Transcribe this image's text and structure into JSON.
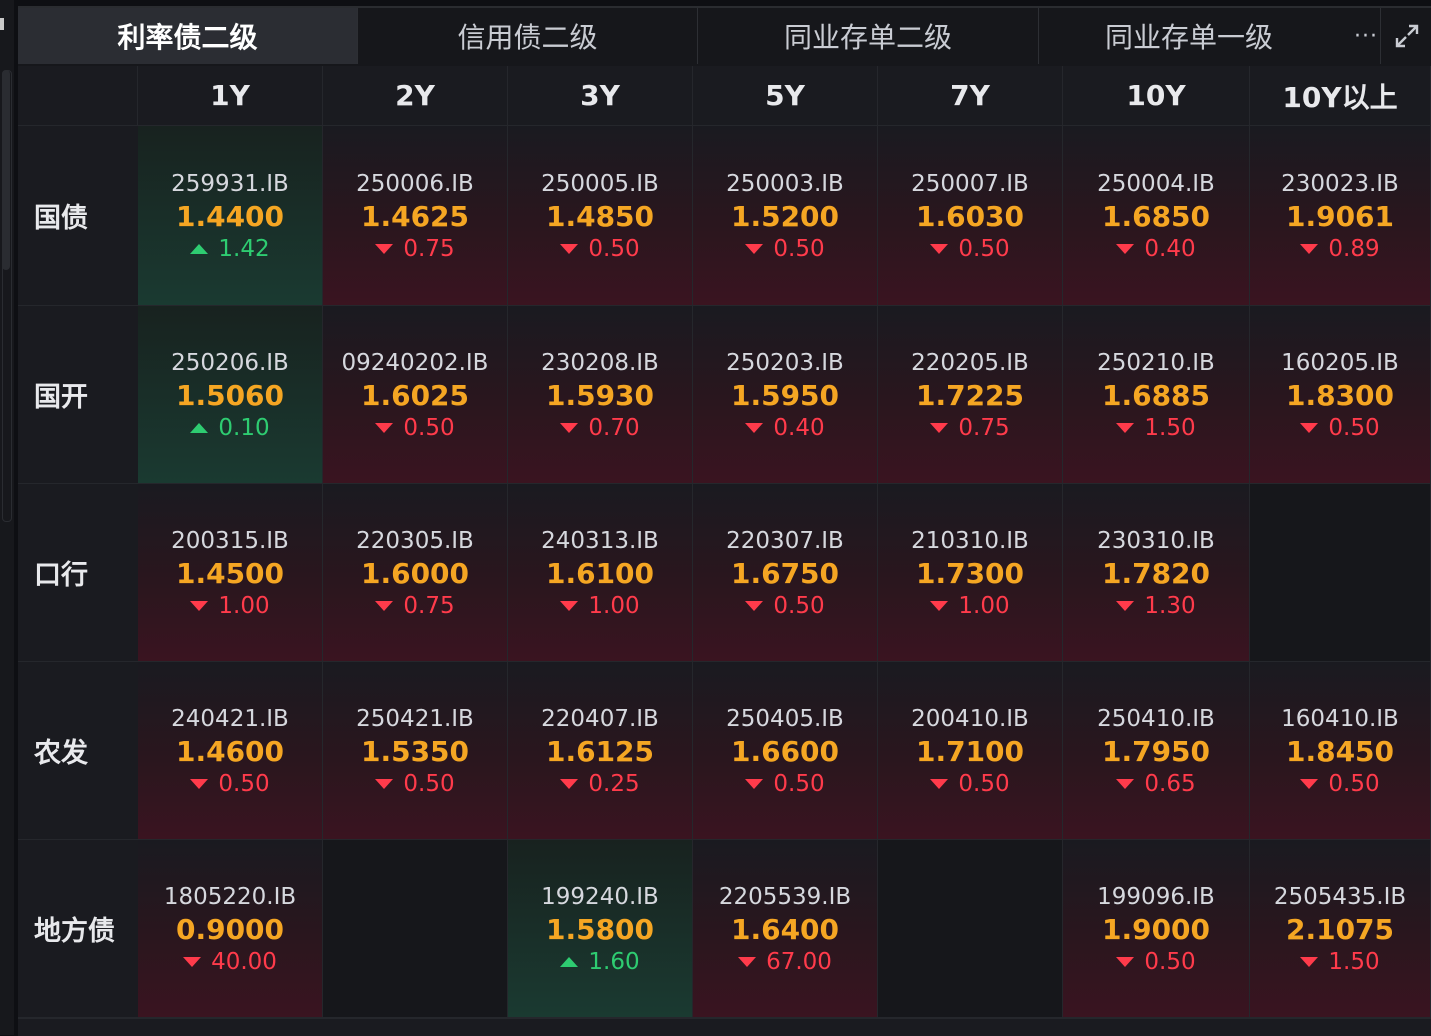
{
  "tabs": [
    {
      "label": "利率债二级",
      "active": true
    },
    {
      "label": "信用债二级",
      "active": false
    },
    {
      "label": "同业存单二级",
      "active": false
    },
    {
      "label": "同业存单一级",
      "active": false
    }
  ],
  "more_label": "···",
  "tenors": [
    "1Y",
    "2Y",
    "3Y",
    "5Y",
    "7Y",
    "10Y",
    "10Y以上"
  ],
  "rows": [
    {
      "label": "国债",
      "cells": [
        {
          "code": "259931.IB",
          "rate": "1.4400",
          "change": "1.42",
          "dir": "up"
        },
        {
          "code": "250006.IB",
          "rate": "1.4625",
          "change": "0.75",
          "dir": "down"
        },
        {
          "code": "250005.IB",
          "rate": "1.4850",
          "change": "0.50",
          "dir": "down"
        },
        {
          "code": "250003.IB",
          "rate": "1.5200",
          "change": "0.50",
          "dir": "down"
        },
        {
          "code": "250007.IB",
          "rate": "1.6030",
          "change": "0.50",
          "dir": "down"
        },
        {
          "code": "250004.IB",
          "rate": "1.6850",
          "change": "0.40",
          "dir": "down"
        },
        {
          "code": "230023.IB",
          "rate": "1.9061",
          "change": "0.89",
          "dir": "down"
        }
      ]
    },
    {
      "label": "国开",
      "cells": [
        {
          "code": "250206.IB",
          "rate": "1.5060",
          "change": "0.10",
          "dir": "up"
        },
        {
          "code": "09240202.IB",
          "rate": "1.6025",
          "change": "0.50",
          "dir": "down"
        },
        {
          "code": "230208.IB",
          "rate": "1.5930",
          "change": "0.70",
          "dir": "down"
        },
        {
          "code": "250203.IB",
          "rate": "1.5950",
          "change": "0.40",
          "dir": "down"
        },
        {
          "code": "220205.IB",
          "rate": "1.7225",
          "change": "0.75",
          "dir": "down"
        },
        {
          "code": "250210.IB",
          "rate": "1.6885",
          "change": "1.50",
          "dir": "down"
        },
        {
          "code": "160205.IB",
          "rate": "1.8300",
          "change": "0.50",
          "dir": "down"
        }
      ]
    },
    {
      "label": "口行",
      "cells": [
        {
          "code": "200315.IB",
          "rate": "1.4500",
          "change": "1.00",
          "dir": "down"
        },
        {
          "code": "220305.IB",
          "rate": "1.6000",
          "change": "0.75",
          "dir": "down"
        },
        {
          "code": "240313.IB",
          "rate": "1.6100",
          "change": "1.00",
          "dir": "down"
        },
        {
          "code": "220307.IB",
          "rate": "1.6750",
          "change": "0.50",
          "dir": "down"
        },
        {
          "code": "210310.IB",
          "rate": "1.7300",
          "change": "1.00",
          "dir": "down"
        },
        {
          "code": "230310.IB",
          "rate": "1.7820",
          "change": "1.30",
          "dir": "down"
        },
        null
      ]
    },
    {
      "label": "农发",
      "cells": [
        {
          "code": "240421.IB",
          "rate": "1.4600",
          "change": "0.50",
          "dir": "down"
        },
        {
          "code": "250421.IB",
          "rate": "1.5350",
          "change": "0.50",
          "dir": "down"
        },
        {
          "code": "220407.IB",
          "rate": "1.6125",
          "change": "0.25",
          "dir": "down"
        },
        {
          "code": "250405.IB",
          "rate": "1.6600",
          "change": "0.50",
          "dir": "down"
        },
        {
          "code": "200410.IB",
          "rate": "1.7100",
          "change": "0.50",
          "dir": "down"
        },
        {
          "code": "250410.IB",
          "rate": "1.7950",
          "change": "0.65",
          "dir": "down"
        },
        {
          "code": "160410.IB",
          "rate": "1.8450",
          "change": "0.50",
          "dir": "down"
        }
      ]
    },
    {
      "label": "地方债",
      "cells": [
        {
          "code": "1805220.IB",
          "rate": "0.9000",
          "change": "40.00",
          "dir": "down"
        },
        null,
        {
          "code": "199240.IB",
          "rate": "1.5800",
          "change": "1.60",
          "dir": "up"
        },
        {
          "code": "2205539.IB",
          "rate": "1.6400",
          "change": "67.00",
          "dir": "down"
        },
        null,
        {
          "code": "199096.IB",
          "rate": "1.9000",
          "change": "0.50",
          "dir": "down"
        },
        {
          "code": "2505435.IB",
          "rate": "2.1075",
          "change": "1.50",
          "dir": "down"
        }
      ]
    }
  ]
}
